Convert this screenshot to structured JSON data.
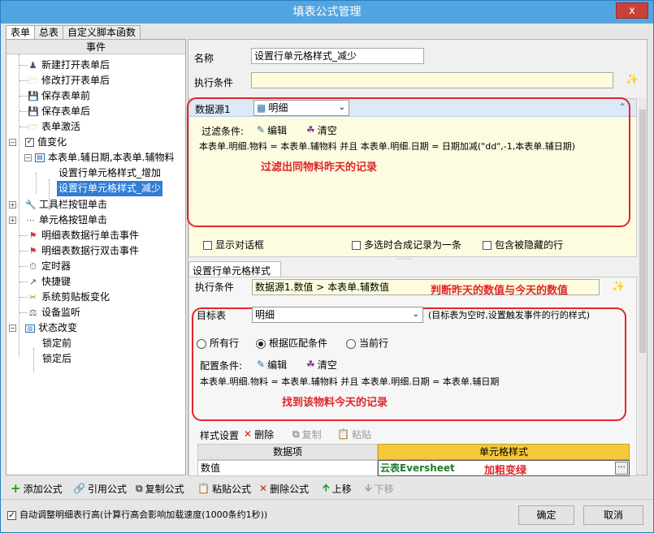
{
  "window": {
    "title": "填表公式管理",
    "close": "x"
  },
  "tabs": [
    "表单",
    "总表",
    "自定义脚本函数"
  ],
  "left": {
    "header": "事件",
    "items": [
      {
        "label": "新建打开表单后",
        "icon": "person-icon"
      },
      {
        "label": "修改打开表单后",
        "icon": "folder-icon"
      },
      {
        "label": "保存表单前",
        "icon": "save-icon"
      },
      {
        "label": "保存表单后",
        "icon": "save-icon"
      },
      {
        "label": "表单激活",
        "icon": "folder-icon"
      },
      {
        "label": "值变化",
        "icon": "checkbox-icon"
      },
      {
        "label": "本表单.辅日期,本表单.辅物料",
        "icon": "form-icon"
      },
      {
        "label": "设置行单元格样式_增加"
      },
      {
        "label": "设置行单元格样式_减少"
      },
      {
        "label": "工具栏按钮单击",
        "icon": "tool-icon"
      },
      {
        "label": "单元格按钮单击",
        "icon": "dots-icon"
      },
      {
        "label": "明细表数据行单击事件",
        "icon": "flag-icon"
      },
      {
        "label": "明细表数据行双击事件",
        "icon": "flag-icon"
      },
      {
        "label": "定时器",
        "icon": "timer-icon"
      },
      {
        "label": "快捷键",
        "icon": "shortcut-icon"
      },
      {
        "label": "系统剪贴板变化",
        "icon": "scissors-icon"
      },
      {
        "label": "设备监听",
        "icon": "device-icon"
      },
      {
        "label": "状态改变",
        "icon": "status-icon"
      },
      {
        "label": "锁定前"
      },
      {
        "label": "锁定后"
      }
    ]
  },
  "form": {
    "name_label": "名称",
    "name_value": "设置行单元格样式_减少",
    "cond_label": "执行条件",
    "cond_value": ""
  },
  "datasource": {
    "label": "数据源1",
    "value": "明细",
    "filter_label": "过滤条件:",
    "edit": "编辑",
    "clear": "清空",
    "filter_text": "本表单.明细.物料 = 本表单.辅物料 并且 本表单.明细.日期 = 日期加减(\"dd\",-1,本表单.辅日期)",
    "annotation": "过滤出同物料昨天的记录",
    "chk_dialog": "显示对话框",
    "chk_merge": "多选时合成记录为一条",
    "chk_hidden": "包含被隐藏的行"
  },
  "style": {
    "tab": "设置行单元格样式",
    "cond_label": "执行条件",
    "cond_value": "数据源1.数值 > 本表单.辅数值",
    "cond_note": "判断昨天的数值与今天的数值",
    "target_label": "目标表",
    "target_value": "明细",
    "target_hint": "(目标表为空时,设置触发事件的行的样式)",
    "radio_all": "所有行",
    "radio_match": "根据匹配条件",
    "radio_current": "当前行",
    "config_label": "配置条件:",
    "edit": "编辑",
    "clear": "清空",
    "config_text": "本表单.明细.物料 = 本表单.辅物料 并且 本表单.明细.日期 = 本表单.辅日期",
    "annotation": "找到该物料今天的记录",
    "toolbar_label": "样式设置",
    "del": "删除",
    "copy": "复制",
    "paste": "粘贴",
    "col_data": "数据项",
    "col_style": "单元格样式",
    "row_data": "数值",
    "row_style": "云表Eversheet",
    "row_note": "加粗变绿",
    "row_btn": "···"
  },
  "bottom": {
    "add": "添加公式",
    "ref": "引用公式",
    "copy": "复制公式",
    "paste": "粘贴公式",
    "delete": "删除公式",
    "up": "上移",
    "down": "下移",
    "auto_adjust": "自动调整明细表行高(计算行高会影响加载速度(1000条约1秒))",
    "ok": "确定",
    "cancel": "取消"
  },
  "colors": {
    "title": "#52a5e0",
    "red": "#e0262c",
    "green": "#1f7a2a",
    "selected": "#2f7dd4"
  }
}
